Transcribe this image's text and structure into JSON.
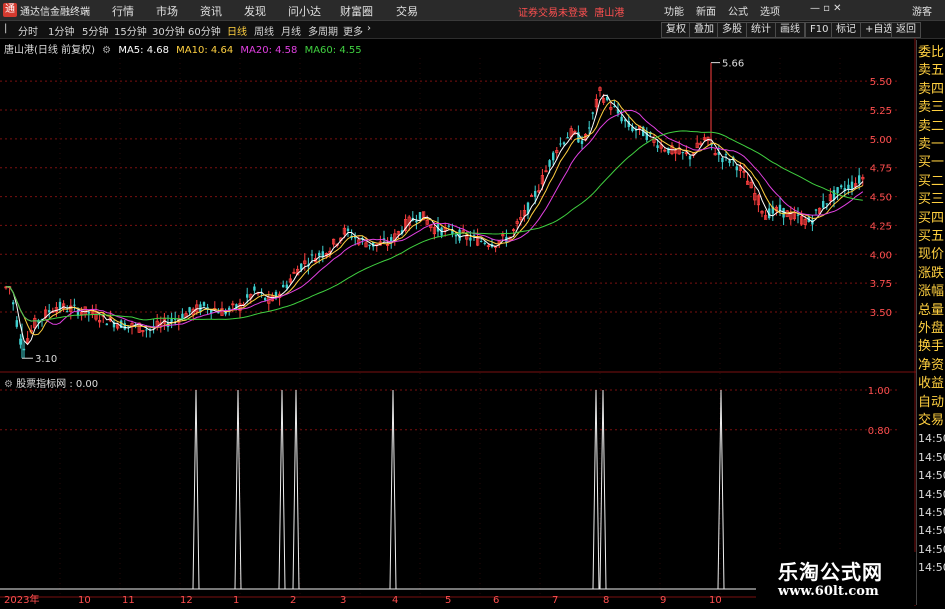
{
  "app": {
    "logo": "通",
    "title": "通达信金融终端"
  },
  "menu": [
    "行情",
    "市场",
    "资讯",
    "发现",
    "问小达",
    "财富圈",
    "交易"
  ],
  "notice": {
    "status": "证券交易未登录",
    "stock": "唐山港"
  },
  "top_right": [
    "功能",
    "新面",
    "公式",
    "选项",
    "游客"
  ],
  "periods": [
    "分时",
    "1分钟",
    "5分钟",
    "15分钟",
    "30分钟",
    "60分钟",
    "日线",
    "周线",
    "月线",
    "多周期",
    "更多"
  ],
  "active_period": "日线",
  "toolbar": [
    "复权",
    "叠加",
    "多股",
    "统计",
    "画线",
    "F10",
    "标记",
    "+自选",
    "返回"
  ],
  "chart": {
    "stock_label": "唐山港(日线 前复权)",
    "ma5": "MA5: 4.68",
    "ma10": "MA10: 4.64",
    "ma20": "MA20: 4.58",
    "ma60": "MA60: 4.55",
    "max_label": "5.66",
    "min_label": "3.10",
    "y_ticks": [
      "5.50",
      "5.25",
      "5.00",
      "4.75",
      "4.50",
      "4.25",
      "4.00",
      "3.75",
      "3.50"
    ]
  },
  "indicator": {
    "label": "股票指标网 : 0.00",
    "y_ticks": [
      "1.00",
      "0.80"
    ]
  },
  "x_labels": [
    "2023年",
    "10",
    "11",
    "12",
    "1",
    "2",
    "3",
    "4",
    "5",
    "6",
    "7",
    "8",
    "9",
    "10"
  ],
  "right_panel": [
    "委比",
    "卖五",
    "卖四",
    "卖三",
    "卖二",
    "卖一",
    "买一",
    "买二",
    "买三",
    "买四",
    "买五",
    "现价",
    "涨跌",
    "涨幅",
    "总量",
    "外盘",
    "换手",
    "净资",
    "收益",
    "自动",
    "交易",
    "14:50",
    "14:50",
    "14:50",
    "14:50",
    "14:50",
    "14:50",
    "14:50",
    "14:50"
  ],
  "watermark": {
    "cn": "乐淘公式网",
    "url": "www.60lt.com"
  },
  "colors": {
    "up": "#ff4040",
    "down": "#3fd0d0",
    "ma5": "#ffffff",
    "ma10": "#ffd040",
    "ma20": "#e040e0",
    "ma60": "#40d040",
    "grid": "#7a1010"
  }
}
